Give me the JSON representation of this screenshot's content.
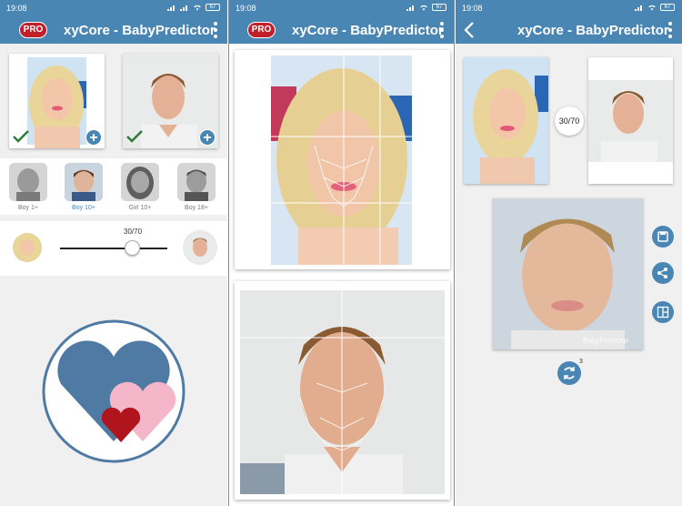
{
  "status_time": "19:08",
  "battery": "67",
  "app_title": "xyCore - BabyPredictor",
  "pro_badge": "PRO",
  "age_options": [
    {
      "label": "Boy 1+"
    },
    {
      "label": "Boy 10+"
    },
    {
      "label": "Girl 10+"
    },
    {
      "label": "Boy 18+"
    }
  ],
  "selected_age": "Boy 10+",
  "blend_ratio": "30/70",
  "result_watermark": "BabyPredictor",
  "regenerate_count": "3",
  "colors": {
    "primary": "#4a86b4",
    "pro": "#c0202a",
    "heart_blue": "#4f7aa3",
    "heart_pink": "#f4b6c8",
    "heart_red": "#b0151e"
  },
  "icons": [
    "check-icon",
    "plus-icon",
    "kebab-menu-icon",
    "back-arrow-icon",
    "save-icon",
    "share-icon",
    "compare-icon",
    "refresh-icon"
  ]
}
